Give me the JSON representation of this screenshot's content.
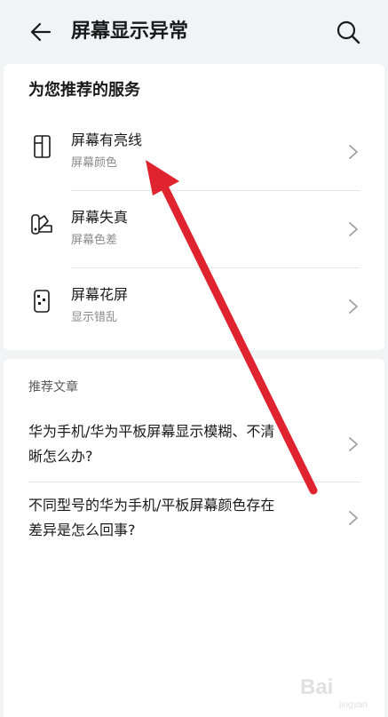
{
  "header": {
    "title": "屏幕显示异常",
    "back_icon": "arrow-left-icon",
    "search_icon": "search-icon"
  },
  "recommended": {
    "section_title": "为您推荐的服务",
    "items": [
      {
        "title": "屏幕有亮线",
        "subtitle": "屏幕颜色",
        "icon": "screen-line-icon"
      },
      {
        "title": "屏幕失真",
        "subtitle": "屏幕色差",
        "icon": "palette-icon"
      },
      {
        "title": "屏幕花屏",
        "subtitle": "显示错乱",
        "icon": "phone-glitch-icon"
      }
    ]
  },
  "articles": {
    "section_title": "推荐文章",
    "items": [
      {
        "line1": "华为手机/华为平板屏幕显示模糊、不清",
        "line2": "晰怎么办?"
      },
      {
        "line1": "不同型号的华为手机/平板屏幕颜色存在",
        "line2": "差异是怎么回事?"
      }
    ]
  },
  "annotation": {
    "color": "#e0242f"
  },
  "watermark": {
    "text": "Bai",
    "sub": "jingyan"
  }
}
